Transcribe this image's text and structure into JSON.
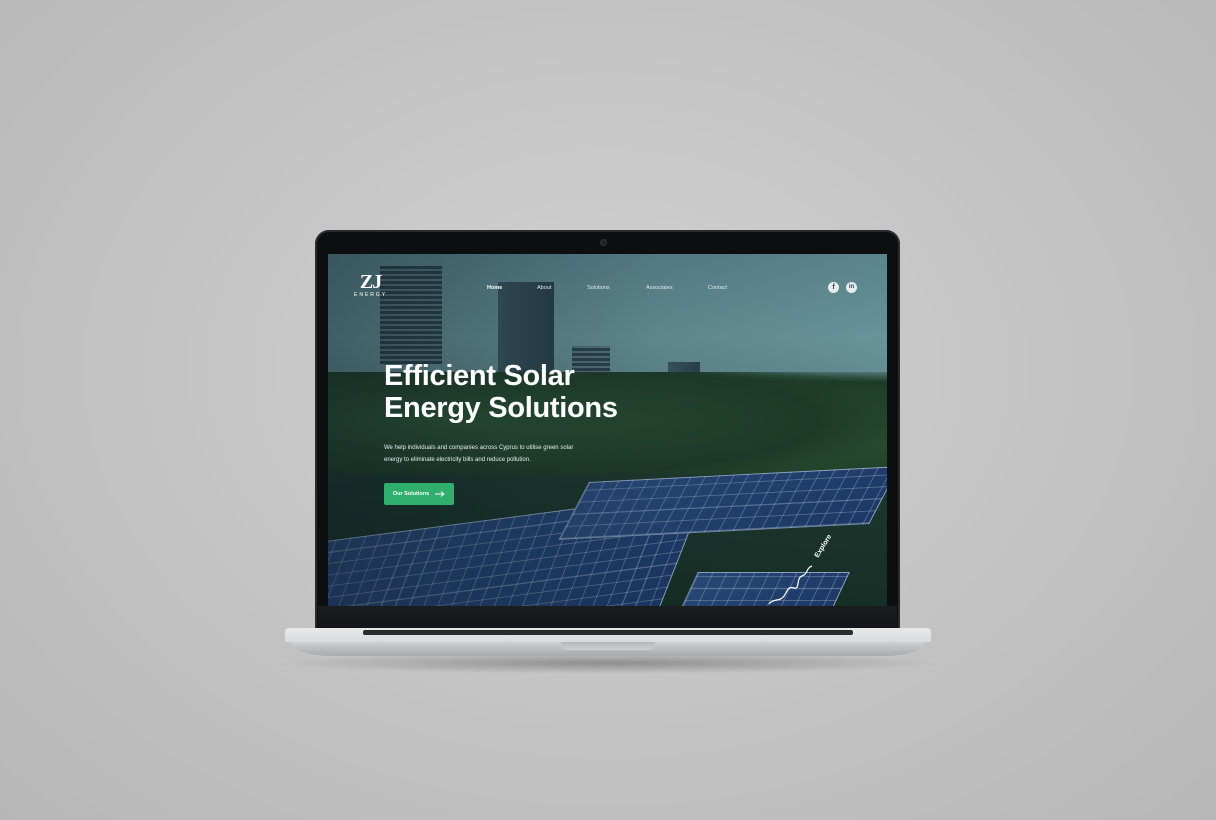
{
  "site": {
    "logo": {
      "mark": "ZJ",
      "text": "ENERGY"
    },
    "nav": [
      {
        "label": "Home",
        "active": true
      },
      {
        "label": "About",
        "active": false
      },
      {
        "label": "Solutions",
        "active": false
      },
      {
        "label": "Associates",
        "active": false
      },
      {
        "label": "Contact",
        "active": false
      }
    ],
    "social": [
      {
        "icon": "facebook-icon",
        "glyph": "f"
      },
      {
        "icon": "linkedin-icon",
        "glyph": "in"
      }
    ]
  },
  "hero": {
    "title_line1": "Efficient Solar",
    "title_line2": "Energy Solutions",
    "subtitle_line1": "We help individuals and companies across Cyprus to utilise green solar",
    "subtitle_line2": "energy to eliminate electricity bills and reduce pollution.",
    "cta_label": "Our Solutions",
    "cta_icon": "arrow-right-icon",
    "explore_label": "Explore"
  },
  "colors": {
    "accent": "#2fae6e",
    "background": "#c8c8c8"
  }
}
